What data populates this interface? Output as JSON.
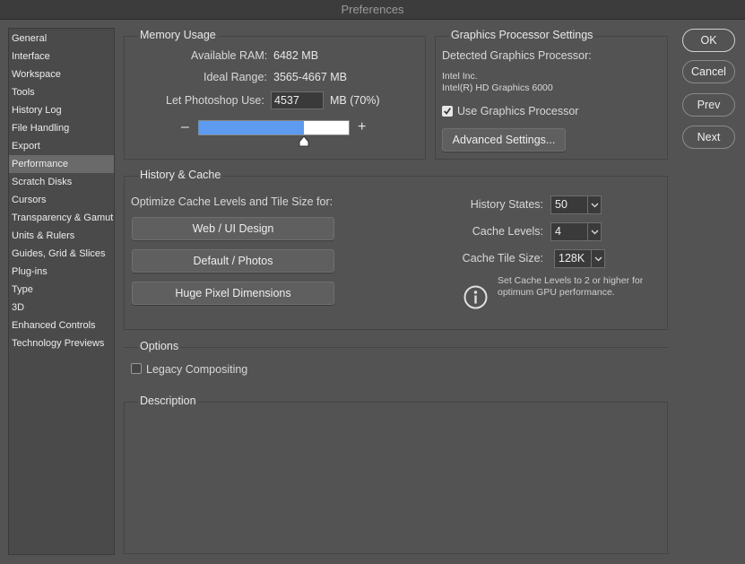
{
  "window": {
    "title": "Preferences"
  },
  "sidebar": {
    "items": [
      {
        "label": "General"
      },
      {
        "label": "Interface"
      },
      {
        "label": "Workspace"
      },
      {
        "label": "Tools"
      },
      {
        "label": "History Log"
      },
      {
        "label": "File Handling"
      },
      {
        "label": "Export"
      },
      {
        "label": "Performance",
        "selected": true
      },
      {
        "label": "Scratch Disks"
      },
      {
        "label": "Cursors"
      },
      {
        "label": "Transparency & Gamut"
      },
      {
        "label": "Units & Rulers"
      },
      {
        "label": "Guides, Grid & Slices"
      },
      {
        "label": "Plug-ins"
      },
      {
        "label": "Type"
      },
      {
        "label": "3D"
      },
      {
        "label": "Enhanced Controls"
      },
      {
        "label": "Technology Previews"
      }
    ]
  },
  "memory": {
    "title": "Memory Usage",
    "available_label": "Available RAM:",
    "available_value": "6482 MB",
    "ideal_label": "Ideal Range:",
    "ideal_value": "3565-4667 MB",
    "use_label": "Let Photoshop Use:",
    "use_value": "4537",
    "use_unit": "MB (70%)",
    "slider_fraction": 0.7,
    "minus": "–",
    "plus": "+"
  },
  "gpu": {
    "title": "Graphics Processor Settings",
    "detected_label": "Detected Graphics Processor:",
    "vendor": "Intel Inc.",
    "model": "Intel(R) HD Graphics 6000",
    "use_gpu_label": "Use Graphics Processor",
    "use_gpu_checked": true,
    "advanced_button": "Advanced Settings..."
  },
  "history_cache": {
    "title": "History & Cache",
    "optimize_label": "Optimize Cache Levels and Tile Size for:",
    "preset_buttons": [
      "Web / UI Design",
      "Default / Photos",
      "Huge Pixel Dimensions"
    ],
    "history_states_label": "History States:",
    "history_states_value": "50",
    "cache_levels_label": "Cache Levels:",
    "cache_levels_value": "4",
    "cache_tile_label": "Cache Tile Size:",
    "cache_tile_value": "128K",
    "info_line1": "Set Cache Levels to 2 or higher for",
    "info_line2": "optimum GPU performance."
  },
  "options": {
    "title": "Options",
    "legacy_label": "Legacy Compositing",
    "legacy_checked": false
  },
  "description": {
    "title": "Description"
  },
  "dialog_buttons": {
    "ok": "OK",
    "cancel": "Cancel",
    "prev": "Prev",
    "next": "Next"
  },
  "colors": {
    "accent": "#5c9bf0",
    "background": "#535353",
    "sidebar_selected": "#6a6a6a"
  },
  "icons": [
    "info-icon",
    "chevron-down-icon",
    "checkmark-icon"
  ]
}
